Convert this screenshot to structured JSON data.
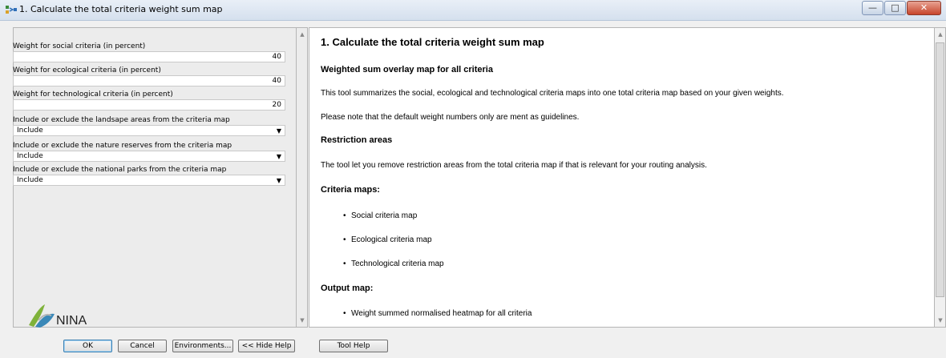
{
  "window": {
    "title": "1. Calculate the total criteria weight sum map",
    "controls": [
      "minimize",
      "maximize",
      "close"
    ]
  },
  "params": [
    {
      "label": "Weight for social criteria (in percent)",
      "value": "40"
    },
    {
      "label": "Weight for ecological criteria (in percent)",
      "value": "40"
    },
    {
      "label": "Weight for technological criteria (in percent)",
      "value": "20"
    },
    {
      "label": "Include or exclude the landsape areas from the criteria map",
      "value": "Include"
    },
    {
      "label": "Include or exclude the nature reserves from the criteria map",
      "value": "Include"
    },
    {
      "label": "Include or exclude the national parks from the criteria map",
      "value": "Include"
    }
  ],
  "logo": {
    "text": "NINA"
  },
  "help": {
    "title": "1. Calculate the total criteria weight sum map",
    "section1": "Weighted sum overlay map for all criteria",
    "p1": "This tool summarizes the social, ecological and technological criteria maps into one total criteria map based on your given weights.",
    "p2": "Please note that the default weight numbers only are ment as guidelines.",
    "section2": "Restriction areas",
    "p3": "The tool let you remove restriction areas from the total criteria map if that is relevant for your routing analysis.",
    "section3": "Criteria maps:",
    "criteria": [
      "Social criteria map",
      "Ecological criteria map",
      "Technological criteria map"
    ],
    "section4": "Output map:",
    "output": [
      "Weight summed normalised heatmap for all criteria"
    ]
  },
  "buttons": {
    "ok": "OK",
    "cancel": "Cancel",
    "environments": "Environments...",
    "hide_help": "<< Hide Help",
    "tool_help": "Tool Help"
  }
}
